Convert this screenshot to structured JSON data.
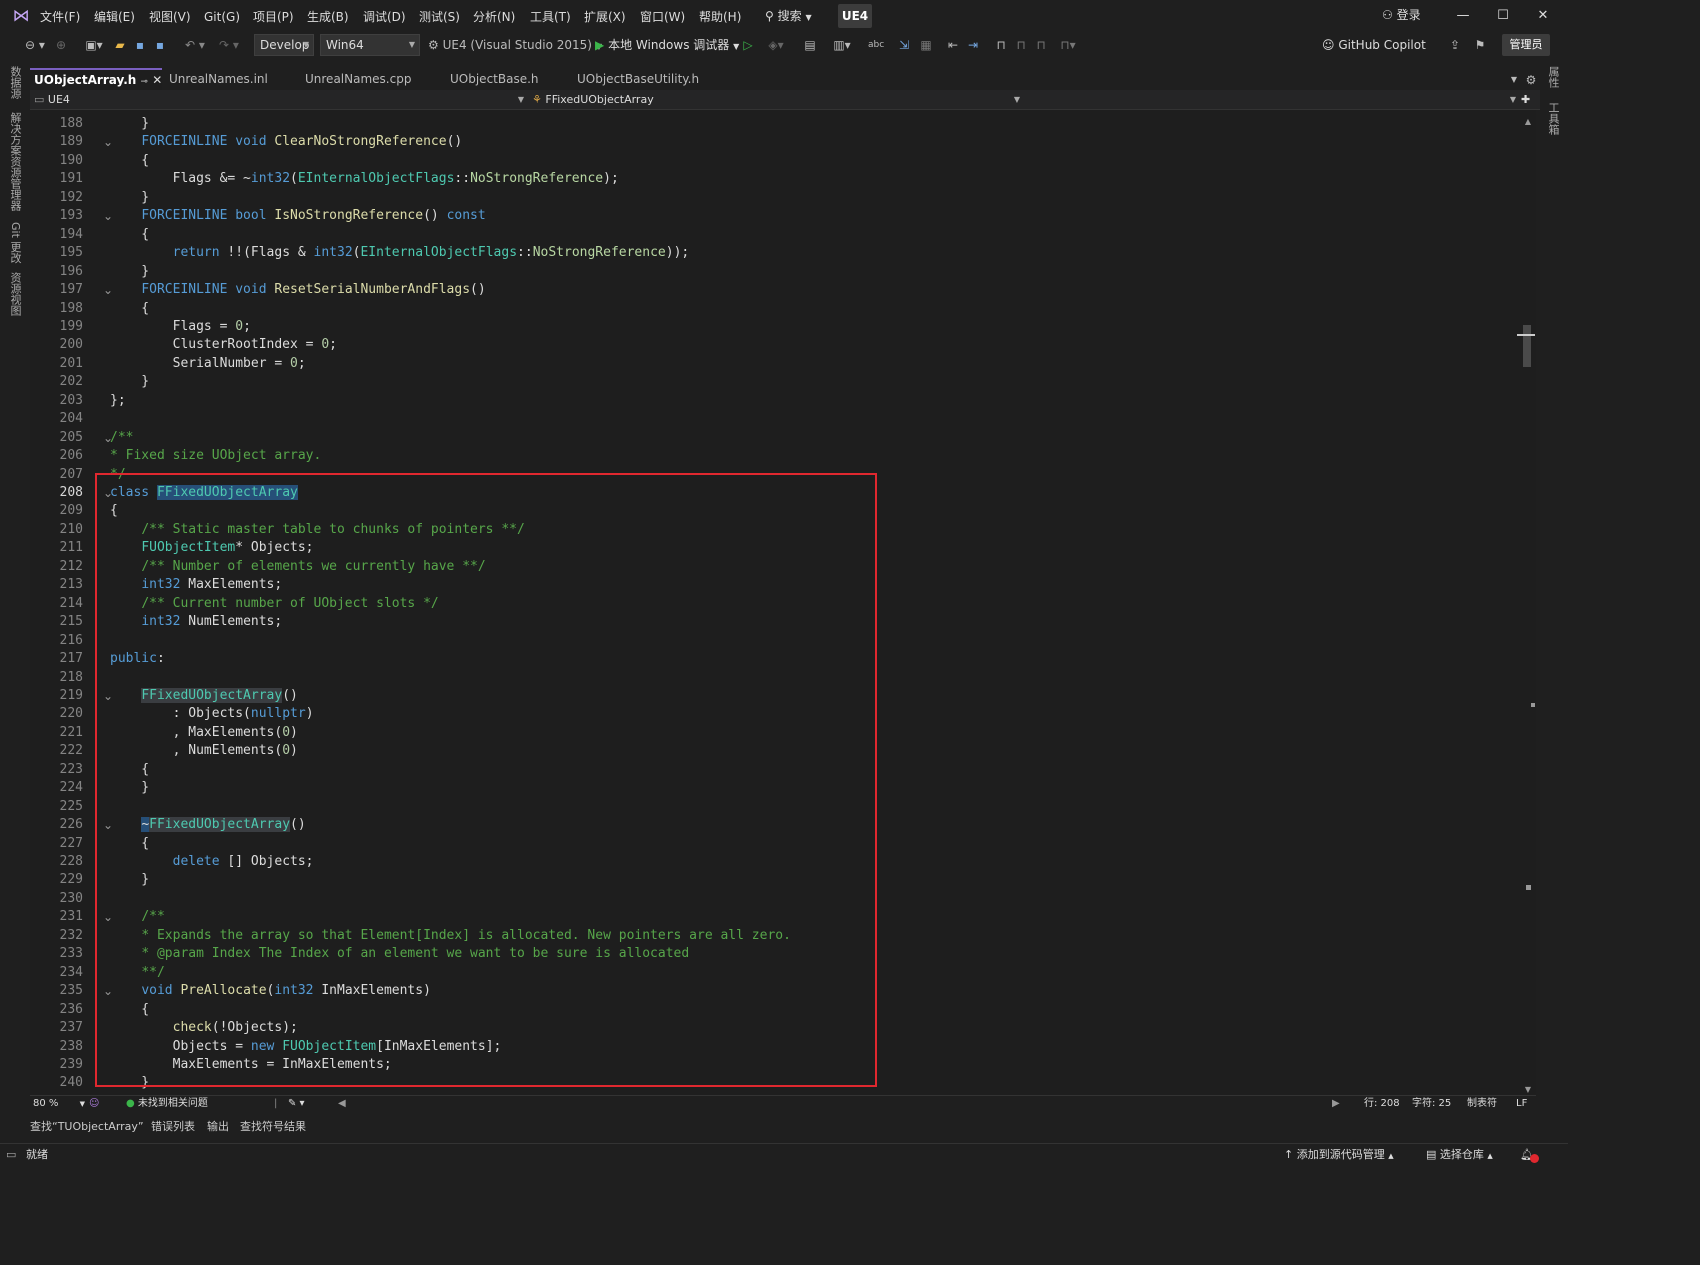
{
  "title_bar": {
    "menus": [
      "文件(F)",
      "编辑(E)",
      "视图(V)",
      "Git(G)",
      "项目(P)",
      "生成(B)",
      "调试(D)",
      "测试(S)",
      "分析(N)",
      "工具(T)",
      "扩展(X)",
      "窗口(W)",
      "帮助(H)"
    ],
    "search_label": "搜索",
    "solution_badge": "UE4",
    "login_label": "登录"
  },
  "toolbar": {
    "config": "Develop",
    "platform": "Win64",
    "startup_project": "UE4 (Visual Studio 2015)",
    "debugger": "本地 Windows 调试器",
    "copilot": "GitHub Copilot",
    "admin": "管理员"
  },
  "left_rail": [
    "数据源",
    "解决方案资源管理器",
    "Git 更改",
    "资源视图"
  ],
  "right_rail": [
    "属性",
    "工具箱"
  ],
  "tabs": [
    {
      "label": "UObjectArray.h",
      "active": true
    },
    {
      "label": "UnrealNames.inl",
      "active": false
    },
    {
      "label": "UnrealNames.cpp",
      "active": false
    },
    {
      "label": "UObjectBase.h",
      "active": false
    },
    {
      "label": "UObjectBaseUtility.h",
      "active": false
    }
  ],
  "nav": {
    "project": "UE4",
    "scope": "FFixedUObjectArray"
  },
  "editor": {
    "current_line": 208,
    "lines": [
      {
        "n": 188,
        "fold": false,
        "s": [
          [
            "    }",
            ""
          ]
        ]
      },
      {
        "n": 189,
        "fold": true,
        "s": [
          [
            "    ",
            ""
          ],
          [
            "FORCEINLINE",
            "m"
          ],
          [
            " ",
            ""
          ],
          [
            "void",
            "k"
          ],
          [
            " ",
            ""
          ],
          [
            "ClearNoStrongReference",
            "f"
          ],
          [
            "()",
            ""
          ]
        ]
      },
      {
        "n": 190,
        "fold": false,
        "s": [
          [
            "    {",
            ""
          ]
        ]
      },
      {
        "n": 191,
        "fold": false,
        "s": [
          [
            "        Flags &= ~",
            ""
          ],
          [
            "int32",
            "k"
          ],
          [
            "(",
            ""
          ],
          [
            "EInternalObjectFlags",
            "t"
          ],
          [
            "::",
            ""
          ],
          [
            "NoStrongReference",
            "e"
          ],
          [
            ");",
            ""
          ]
        ]
      },
      {
        "n": 192,
        "fold": false,
        "s": [
          [
            "    }",
            ""
          ]
        ]
      },
      {
        "n": 193,
        "fold": true,
        "s": [
          [
            "    ",
            ""
          ],
          [
            "FORCEINLINE",
            "m"
          ],
          [
            " ",
            ""
          ],
          [
            "bool",
            "k"
          ],
          [
            " ",
            ""
          ],
          [
            "IsNoStrongReference",
            "f"
          ],
          [
            "() ",
            ""
          ],
          [
            "const",
            "k"
          ]
        ]
      },
      {
        "n": 194,
        "fold": false,
        "s": [
          [
            "    {",
            ""
          ]
        ]
      },
      {
        "n": 195,
        "fold": false,
        "s": [
          [
            "        ",
            ""
          ],
          [
            "return",
            "k"
          ],
          [
            " !!(Flags & ",
            ""
          ],
          [
            "int32",
            "k"
          ],
          [
            "(",
            ""
          ],
          [
            "EInternalObjectFlags",
            "t"
          ],
          [
            "::",
            ""
          ],
          [
            "NoStrongReference",
            "e"
          ],
          [
            "));",
            ""
          ]
        ]
      },
      {
        "n": 196,
        "fold": false,
        "s": [
          [
            "    }",
            ""
          ]
        ]
      },
      {
        "n": 197,
        "fold": true,
        "s": [
          [
            "    ",
            ""
          ],
          [
            "FORCEINLINE",
            "m"
          ],
          [
            " ",
            ""
          ],
          [
            "void",
            "k"
          ],
          [
            " ",
            ""
          ],
          [
            "ResetSerialNumberAndFlags",
            "f"
          ],
          [
            "()",
            ""
          ]
        ]
      },
      {
        "n": 198,
        "fold": false,
        "s": [
          [
            "    {",
            ""
          ]
        ]
      },
      {
        "n": 199,
        "fold": false,
        "s": [
          [
            "        Flags = ",
            ""
          ],
          [
            "0",
            "n"
          ],
          [
            ";",
            ""
          ]
        ]
      },
      {
        "n": 200,
        "fold": false,
        "s": [
          [
            "        ClusterRootIndex = ",
            ""
          ],
          [
            "0",
            "n"
          ],
          [
            ";",
            ""
          ]
        ]
      },
      {
        "n": 201,
        "fold": false,
        "s": [
          [
            "        SerialNumber = ",
            ""
          ],
          [
            "0",
            "n"
          ],
          [
            ";",
            ""
          ]
        ]
      },
      {
        "n": 202,
        "fold": false,
        "s": [
          [
            "    }",
            ""
          ]
        ]
      },
      {
        "n": 203,
        "fold": false,
        "s": [
          [
            "};",
            ""
          ]
        ]
      },
      {
        "n": 204,
        "fold": false,
        "s": []
      },
      {
        "n": 205,
        "fold": true,
        "s": [
          [
            "/**",
            "c"
          ]
        ]
      },
      {
        "n": 206,
        "fold": false,
        "s": [
          [
            "* Fixed size UObject array.",
            "c"
          ]
        ]
      },
      {
        "n": 207,
        "fold": false,
        "s": [
          [
            "*/",
            "c"
          ]
        ]
      },
      {
        "n": 208,
        "fold": true,
        "s": [
          [
            "class",
            "k"
          ],
          [
            " ",
            ""
          ],
          [
            "FFixedUObjectArray",
            "t hl"
          ]
        ]
      },
      {
        "n": 209,
        "fold": false,
        "s": [
          [
            "{",
            ""
          ]
        ]
      },
      {
        "n": 210,
        "fold": false,
        "s": [
          [
            "    ",
            ""
          ],
          [
            "/** Static master table to chunks of pointers **/",
            "c"
          ]
        ]
      },
      {
        "n": 211,
        "fold": false,
        "s": [
          [
            "    ",
            ""
          ],
          [
            "FUObjectItem",
            "t"
          ],
          [
            "* Objects;",
            ""
          ]
        ]
      },
      {
        "n": 212,
        "fold": false,
        "s": [
          [
            "    ",
            ""
          ],
          [
            "/** Number of elements we currently have **/",
            "c"
          ]
        ]
      },
      {
        "n": 213,
        "fold": false,
        "s": [
          [
            "    ",
            ""
          ],
          [
            "int32",
            "k"
          ],
          [
            " MaxElements;",
            ""
          ]
        ]
      },
      {
        "n": 214,
        "fold": false,
        "s": [
          [
            "    ",
            ""
          ],
          [
            "/** Current number of UObject slots */",
            "c"
          ]
        ]
      },
      {
        "n": 215,
        "fold": false,
        "s": [
          [
            "    ",
            ""
          ],
          [
            "int32",
            "k"
          ],
          [
            " NumElements;",
            ""
          ]
        ]
      },
      {
        "n": 216,
        "fold": false,
        "s": []
      },
      {
        "n": 217,
        "fold": false,
        "s": [
          [
            "public",
            "k"
          ],
          [
            ":",
            ""
          ]
        ]
      },
      {
        "n": 218,
        "fold": false,
        "s": []
      },
      {
        "n": 219,
        "fold": true,
        "s": [
          [
            "    ",
            ""
          ],
          [
            "FFixedUObjectArray",
            "t hl2"
          ],
          [
            "()",
            ""
          ]
        ]
      },
      {
        "n": 220,
        "fold": false,
        "s": [
          [
            "        : Objects(",
            ""
          ],
          [
            "nullptr",
            "k"
          ],
          [
            ")",
            ""
          ]
        ]
      },
      {
        "n": 221,
        "fold": false,
        "s": [
          [
            "        , MaxElements(",
            ""
          ],
          [
            "0",
            "n"
          ],
          [
            ")",
            ""
          ]
        ]
      },
      {
        "n": 222,
        "fold": false,
        "s": [
          [
            "        , NumElements(",
            ""
          ],
          [
            "0",
            "n"
          ],
          [
            ")",
            ""
          ]
        ]
      },
      {
        "n": 223,
        "fold": false,
        "s": [
          [
            "    {",
            ""
          ]
        ]
      },
      {
        "n": 224,
        "fold": false,
        "s": [
          [
            "    }",
            ""
          ]
        ]
      },
      {
        "n": 225,
        "fold": false,
        "s": []
      },
      {
        "n": 226,
        "fold": true,
        "s": [
          [
            "    ",
            ""
          ],
          [
            "~",
            "hl"
          ],
          [
            "FFixedUObjectArray",
            "t hl2"
          ],
          [
            "()",
            ""
          ]
        ]
      },
      {
        "n": 227,
        "fold": false,
        "s": [
          [
            "    {",
            ""
          ]
        ]
      },
      {
        "n": 228,
        "fold": false,
        "s": [
          [
            "        ",
            ""
          ],
          [
            "delete",
            "k"
          ],
          [
            " [] Objects;",
            ""
          ]
        ]
      },
      {
        "n": 229,
        "fold": false,
        "s": [
          [
            "    }",
            ""
          ]
        ]
      },
      {
        "n": 230,
        "fold": false,
        "s": []
      },
      {
        "n": 231,
        "fold": true,
        "s": [
          [
            "    ",
            ""
          ],
          [
            "/**",
            "c"
          ]
        ]
      },
      {
        "n": 232,
        "fold": false,
        "s": [
          [
            "    ",
            ""
          ],
          [
            "* Expands the array so that Element[Index] is allocated. New pointers are all zero.",
            "c"
          ]
        ]
      },
      {
        "n": 233,
        "fold": false,
        "s": [
          [
            "    ",
            ""
          ],
          [
            "* @param Index The Index of an element we want to be sure is allocated",
            "c"
          ]
        ]
      },
      {
        "n": 234,
        "fold": false,
        "s": [
          [
            "    ",
            ""
          ],
          [
            "**/",
            "c"
          ]
        ]
      },
      {
        "n": 235,
        "fold": true,
        "s": [
          [
            "    ",
            ""
          ],
          [
            "void",
            "k"
          ],
          [
            " ",
            ""
          ],
          [
            "PreAllocate",
            "f"
          ],
          [
            "(",
            ""
          ],
          [
            "int32",
            "k"
          ],
          [
            " InMaxElements)",
            ""
          ]
        ]
      },
      {
        "n": 236,
        "fold": false,
        "s": [
          [
            "    {",
            ""
          ]
        ]
      },
      {
        "n": 237,
        "fold": false,
        "s": [
          [
            "        ",
            ""
          ],
          [
            "check",
            "f"
          ],
          [
            "(!Objects);",
            ""
          ]
        ]
      },
      {
        "n": 238,
        "fold": false,
        "s": [
          [
            "        Objects = ",
            ""
          ],
          [
            "new",
            "k"
          ],
          [
            " ",
            ""
          ],
          [
            "FUObjectItem",
            "t"
          ],
          [
            "[InMaxElements];",
            ""
          ]
        ]
      },
      {
        "n": 239,
        "fold": false,
        "s": [
          [
            "        MaxElements = InMaxElements;",
            ""
          ]
        ]
      },
      {
        "n": 240,
        "fold": false,
        "s": [
          [
            "    }",
            ""
          ]
        ]
      }
    ]
  },
  "status_line": {
    "zoom": "80 %",
    "issues": "未找到相关问题",
    "row": "行: 208",
    "col": "字符: 25",
    "tabs": "制表符",
    "eol": "LF"
  },
  "bottom_tabs": [
    "查找“TUObjectArray”",
    "错误列表",
    "输出",
    "查找符号结果"
  ],
  "status_bar": {
    "ready": "就绪",
    "add_source_control": "添加到源代码管理",
    "select_repo": "选择仓库"
  },
  "colors": {
    "accent": "#7a5fc0",
    "annotation_box": "#e0282f",
    "highlight": "#264f78"
  }
}
